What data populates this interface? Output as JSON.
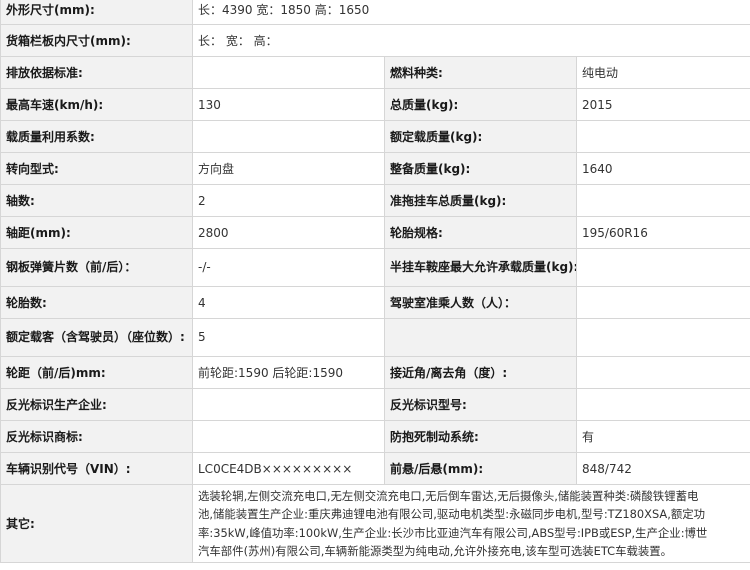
{
  "dims_row": {
    "label": "外形尺寸(mm):",
    "value": "长：4390 宽：1850 高：1650"
  },
  "cargo_row": {
    "label": "货箱栏板内尺寸(mm):",
    "value": "长： 宽： 高："
  },
  "rows": [
    {
      "l1": "排放依据标准:",
      "v1": "",
      "l2": "燃料种类:",
      "v2": "纯电动"
    },
    {
      "l1": "最高车速(km/h):",
      "v1": "130",
      "l2": "总质量(kg):",
      "v2": "2015"
    },
    {
      "l1": "载质量利用系数:",
      "v1": "",
      "l2": "额定载质量(kg):",
      "v2": ""
    },
    {
      "l1": "转向型式:",
      "v1": "方向盘",
      "l2": "整备质量(kg):",
      "v2": "1640"
    },
    {
      "l1": "轴数:",
      "v1": "2",
      "l2": "准拖挂车总质量(kg):",
      "v2": ""
    },
    {
      "l1": "轴距(mm):",
      "v1": "2800",
      "l2": "轮胎规格:",
      "v2": "195/60R16"
    },
    {
      "l1": "钢板弹簧片数（前/后）：",
      "v1": "-/-",
      "l2": "半挂车鞍座最大允许承载质量(kg):",
      "v2": ""
    },
    {
      "l1": "轮胎数:",
      "v1": "4",
      "l2": "驾驶室准乘人数（人）：",
      "v2": ""
    },
    {
      "l1": "额定载客（含驾驶员）（座位数）:",
      "v1": "5",
      "l2": "",
      "v2": ""
    },
    {
      "l1": "轮距（前/后)mm:",
      "v1": "前轮距:1590 后轮距:1590",
      "l2": "接近角/离去角（度）:",
      "v2": ""
    },
    {
      "l1": "反光标识生产企业:",
      "v1": "",
      "l2": "反光标识型号:",
      "v2": ""
    },
    {
      "l1": "反光标识商标:",
      "v1": "",
      "l2": "防抱死制动系统:",
      "v2": "有"
    },
    {
      "l1": "车辆识别代号（VIN）:",
      "v1": "LC0CE4DB×××××××××",
      "l2": "前悬/后悬(mm):",
      "v2": "848/742"
    }
  ],
  "notes_row": {
    "label": "其它:",
    "lines": [
      "选装轮辋,左侧交流充电口,无左侧交流充电口,无后倒车雷达,无后摄像头,储能装置种类:磷酸铁锂蓄电",
      "池,储能装置生产企业:重庆弗迪锂电池有限公司,驱动电机类型:永磁同步电机,型号:TZ180XSA,额定功",
      "率:35kW,峰值功率:100kW,生产企业:长沙市比亚迪汽车有限公司,ABS型号:IPB或ESP,生产企业:博世",
      "汽车部件(苏州)有限公司,车辆新能源类型为纯电动,允许外接充电,该车型可选装ETC车载装置。"
    ]
  }
}
